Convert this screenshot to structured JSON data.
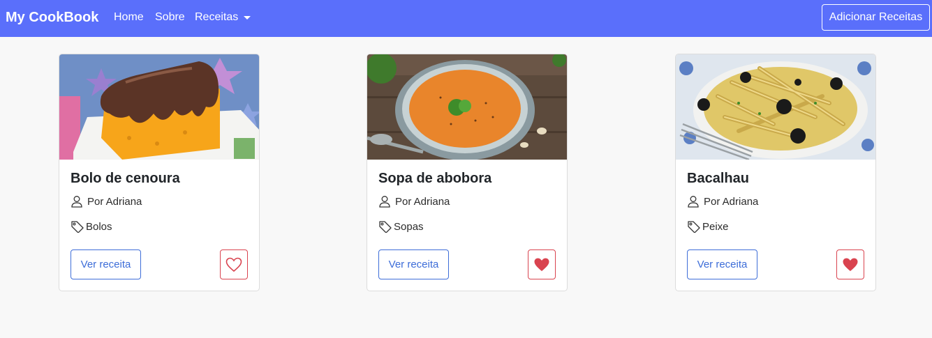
{
  "navbar": {
    "brand": "My CookBook",
    "links": [
      "Home",
      "Sobre"
    ],
    "dropdown_label": "Receitas",
    "add_button": "Adicionar Receitas",
    "bg_color": "#5a6ffb"
  },
  "cards": [
    {
      "title": "Bolo de cenoura",
      "author": "Por Adriana",
      "tag": "Bolos",
      "button": "Ver receita",
      "favorited": false,
      "image": "carrot-cake-photo"
    },
    {
      "title": "Sopa de abobora",
      "author": "Por Adriana",
      "tag": "Sopas",
      "button": "Ver receita",
      "favorited": true,
      "image": "pumpkin-soup-photo"
    },
    {
      "title": "Bacalhau",
      "author": "Por Adriana",
      "tag": "Peixe",
      "button": "Ver receita",
      "favorited": true,
      "image": "codfish-pasta-photo"
    }
  ],
  "colors": {
    "primary_outline": "#3d6dd8",
    "danger": "#d9434f"
  }
}
